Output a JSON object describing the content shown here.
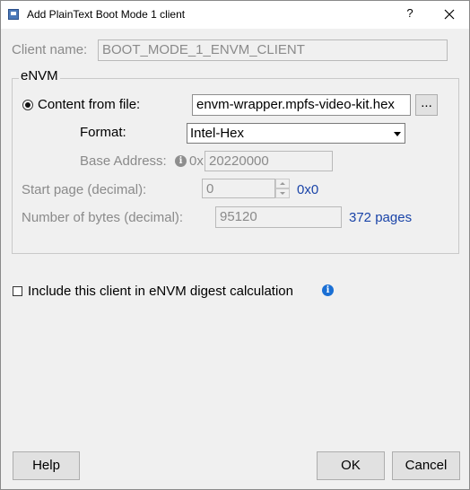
{
  "window": {
    "title": "Add PlainText Boot Mode 1 client",
    "help_glyph": "?"
  },
  "client": {
    "name_label": "Client name:",
    "name_value": "BOOT_MODE_1_ENVM_CLIENT"
  },
  "envm": {
    "group_title": "eNVM",
    "content_label": "Content from file:",
    "file_value": "envm-wrapper.mpfs-video-kit.hex",
    "browse_label": "...",
    "format_label": "Format:",
    "format_value": "Intel-Hex",
    "base_address_label": "Base Address:",
    "base_address_prefix": "0x",
    "base_address_value": "20220000",
    "start_page_label": "Start page (decimal):",
    "start_page_value": "0",
    "start_page_hex": "0x0",
    "bytes_label": "Number of bytes (decimal):",
    "bytes_value": "95120",
    "pages_text": "372 pages"
  },
  "digest": {
    "label": "Include this client in eNVM digest calculation",
    "checked": false
  },
  "buttons": {
    "help": "Help",
    "ok": "OK",
    "cancel": "Cancel"
  },
  "icons": {
    "app": "app-window-icon",
    "close": "close-icon",
    "info": "info-icon"
  },
  "colors": {
    "link_blue": "#1a44a8",
    "info_blue": "#1a6fd4",
    "disabled_text": "#8a8a8a"
  }
}
